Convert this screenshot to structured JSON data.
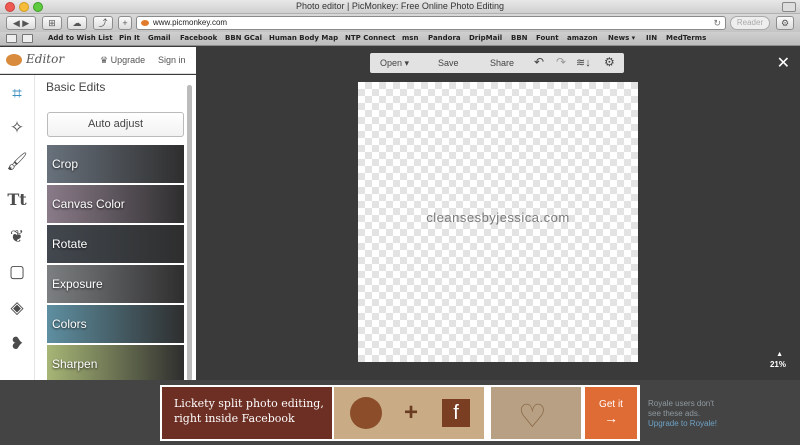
{
  "window": {
    "title": "Photo editor | PicMonkey: Free Online Photo Editing"
  },
  "toolbar": {
    "url": "www.picmonkey.com",
    "reader_label": "Reader"
  },
  "bookmarks": [
    "Add to Wish List",
    "Pin It",
    "Gmail",
    "Facebook",
    "BBN GCal",
    "Human Body Map",
    "NTP Connect",
    "msn",
    "Pandora",
    "DripMail",
    "BBN",
    "Fount",
    "amazon",
    "News ▾",
    "IIN",
    "MedTerms"
  ],
  "app": {
    "logo": "Editor",
    "upgrade": "Upgrade",
    "signin": "Sign in",
    "panel_title": "Basic Edits",
    "auto_adjust": "Auto adjust",
    "edits": [
      "Crop",
      "Canvas Color",
      "Rotate",
      "Exposure",
      "Colors",
      "Sharpen"
    ],
    "edit_colors": [
      "#68717c",
      "#8a7b89",
      "#42484f",
      "#7c7f81",
      "#5e8fa1",
      "#a7b676"
    ],
    "top_menu": {
      "open": "Open",
      "save": "Save",
      "share": "Share"
    },
    "watermark": "cleansesbyjessica.com",
    "zoom": "21%"
  },
  "ad": {
    "headline_line1": "Lickety split photo editing,",
    "headline_line2": "right inside Facebook",
    "cta": "Get it",
    "royale_line1": "Royale users don't",
    "royale_line2": "see these ads.",
    "royale_link": "Upgrade to Royale!"
  }
}
